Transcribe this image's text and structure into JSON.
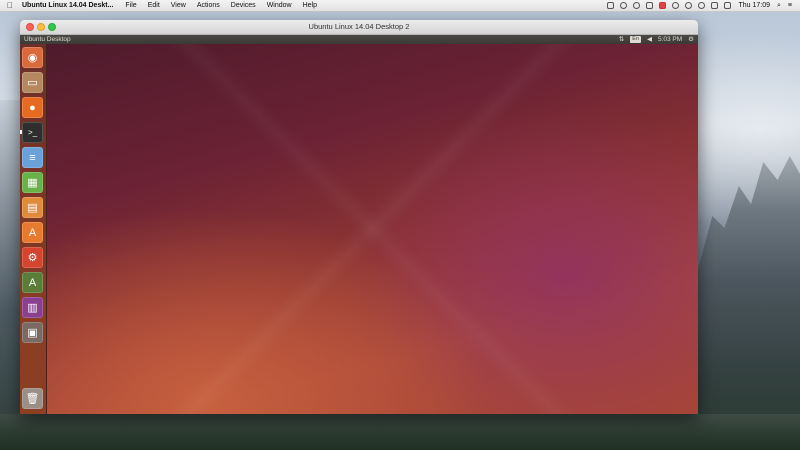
{
  "mac_menubar": {
    "app_name": "Ubuntu Linux 14.04 Deskt...",
    "menus": [
      "File",
      "Edit",
      "View",
      "Actions",
      "Devices",
      "Window",
      "Help"
    ],
    "clock": "Thu 17:09"
  },
  "vm_window": {
    "title": "Ubuntu Linux 14.04 Desktop 2"
  },
  "ubuntu_panel": {
    "title": "Ubuntu Desktop",
    "keyboard": "En",
    "clock": "5:03 PM"
  },
  "launcher": {
    "items": [
      {
        "name": "dash-home-icon",
        "bg": "#d96b3a",
        "glyph": "◉"
      },
      {
        "name": "files-icon",
        "bg": "#b58860",
        "glyph": "▭"
      },
      {
        "name": "firefox-icon",
        "bg": "#e66a1f",
        "glyph": "●"
      },
      {
        "name": "terminal-icon",
        "bg": "#2e2e2e",
        "glyph": ">_"
      },
      {
        "name": "writer-icon",
        "bg": "#6aa1d8",
        "glyph": "≡"
      },
      {
        "name": "calc-icon",
        "bg": "#69b24a",
        "glyph": "▦"
      },
      {
        "name": "impress-icon",
        "bg": "#e08a3c",
        "glyph": "▤"
      },
      {
        "name": "software-center-icon",
        "bg": "#e87a2e",
        "glyph": "A"
      },
      {
        "name": "system-settings-icon",
        "bg": "#d4442e",
        "glyph": "⚙"
      },
      {
        "name": "software-updater-icon",
        "bg": "#5a7d3a",
        "glyph": "A"
      },
      {
        "name": "workspace-switcher-icon",
        "bg": "#8a3f8f",
        "glyph": "▥"
      },
      {
        "name": "removable-drive-icon",
        "bg": "#7a6a62",
        "glyph": "▣"
      },
      {
        "name": "trash-icon",
        "bg": "#9a8e86",
        "glyph": "🗑"
      }
    ]
  }
}
